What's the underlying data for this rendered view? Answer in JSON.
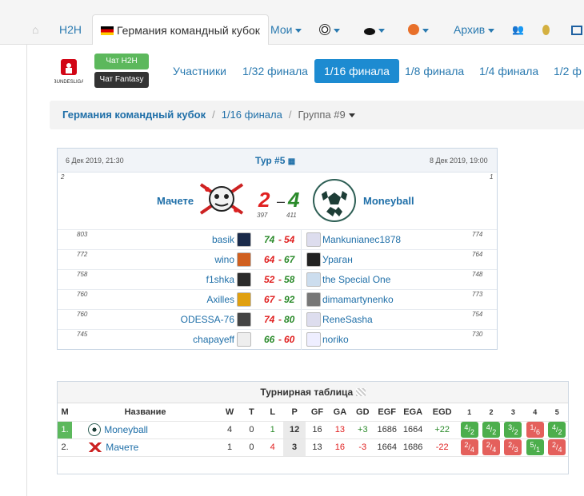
{
  "topnav": {
    "home_icon": "home-icon",
    "h2h": "H2H",
    "active_tab": "Германия командный кубок",
    "mine": "Мои",
    "archive": "Архив",
    "icons": [
      "soccer-icon",
      "hockey-icon",
      "basketball-icon",
      "users-icon",
      "medal-icon",
      "grid-icon"
    ]
  },
  "subheader": {
    "chat_h2h": "Чат H2H",
    "chat_fantasy": "Чат Fantasy",
    "tabs": [
      "Участники",
      "1/32 финала",
      "1/16 финала",
      "1/8 финала",
      "1/4 финала",
      "1/2 ф"
    ]
  },
  "breadcrumb": {
    "root": "Германия командный кубок",
    "stage": "1/16 финала",
    "group": "Группа #9"
  },
  "match": {
    "date_left": "6 Дек 2019, 21:30",
    "round": "Тур #5",
    "date_right": "8 Дек 2019, 19:00",
    "rank_left": "2",
    "rank_right": "1",
    "team_home": "Мачете",
    "team_away": "Moneyball",
    "score_home": "2",
    "dash": "–",
    "score_away": "4",
    "points_home": "397",
    "points_away": "411",
    "players": [
      {
        "rating_l": "803",
        "name_l": "basik",
        "s1": "74",
        "s2": "54",
        "name_r": "Mankunianec1878",
        "rating_r": "774"
      },
      {
        "rating_l": "772",
        "name_l": "wino",
        "s1": "64",
        "s2": "67",
        "name_r": "Ураган",
        "rating_r": "764"
      },
      {
        "rating_l": "758",
        "name_l": "f1shka",
        "s1": "52",
        "s2": "58",
        "name_r": "the Special One",
        "rating_r": "748"
      },
      {
        "rating_l": "760",
        "name_l": "Axilles",
        "s1": "67",
        "s2": "92",
        "name_r": "dimamartynenko",
        "rating_r": "773"
      },
      {
        "rating_l": "760",
        "name_l": "ODESSA-76",
        "s1": "74",
        "s2": "80",
        "name_r": "ReneSasha",
        "rating_r": "754"
      },
      {
        "rating_l": "745",
        "name_l": "chapayeff",
        "s1": "66",
        "s2": "60",
        "name_r": "noriko",
        "rating_r": "730"
      }
    ],
    "score_sep": "-"
  },
  "standings": {
    "title": "Турнирная таблица",
    "headers": [
      "M",
      "Название",
      "W",
      "T",
      "L",
      "P",
      "GF",
      "GA",
      "GD",
      "EGF",
      "EGA",
      "EGD",
      "1",
      "2",
      "3",
      "4",
      "5"
    ],
    "rows": [
      {
        "pos": "1.",
        "team": "Moneyball",
        "w": "4",
        "t": "0",
        "l": "1",
        "p": "12",
        "gf": "16",
        "ga": "13",
        "gd": "+3",
        "egf": "1686",
        "ega": "1664",
        "egd": "+22",
        "res": [
          [
            "4",
            "2"
          ],
          [
            "4",
            "2"
          ],
          [
            "3",
            "2"
          ],
          [
            "1",
            "6"
          ],
          [
            "4",
            "2"
          ]
        ]
      },
      {
        "pos": "2.",
        "team": "Мачете",
        "w": "1",
        "t": "0",
        "l": "4",
        "p": "3",
        "gf": "13",
        "ga": "16",
        "gd": "-3",
        "egf": "1664",
        "ega": "1686",
        "egd": "-22",
        "res": [
          [
            "2",
            "4"
          ],
          [
            "2",
            "4"
          ],
          [
            "2",
            "3"
          ],
          [
            "5",
            "1"
          ],
          [
            "2",
            "4"
          ]
        ]
      }
    ]
  }
}
